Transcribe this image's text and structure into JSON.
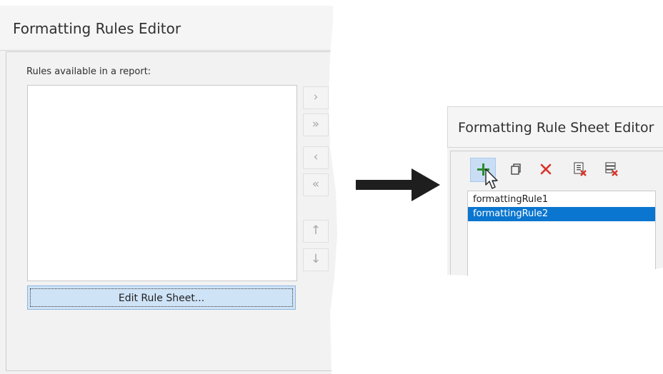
{
  "rules_editor": {
    "title": "Formatting Rules Editor",
    "rules_label": "Rules available in a report:",
    "side_buttons": [
      {
        "glyph": "›",
        "icon": "move-right-icon"
      },
      {
        "glyph": "»",
        "icon": "move-all-right-icon"
      },
      {
        "glyph": "‹",
        "icon": "move-left-icon"
      },
      {
        "glyph": "«",
        "icon": "move-all-left-icon"
      },
      {
        "glyph": "↑",
        "icon": "move-up-icon"
      },
      {
        "glyph": "↓",
        "icon": "move-down-icon"
      }
    ],
    "edit_button_label": "Edit Rule Sheet..."
  },
  "sheet_editor": {
    "title": "Formatting Rule Sheet Editor",
    "toolbar": [
      {
        "icon": "add-icon",
        "color": "#2e8b2e"
      },
      {
        "icon": "copy-icon",
        "color": "#3a3a3a"
      },
      {
        "icon": "delete-icon",
        "color": "#d9342b"
      },
      {
        "icon": "purge-icon",
        "color": "#d9342b"
      },
      {
        "icon": "clear-icon",
        "color": "#d9342b"
      }
    ],
    "rules": [
      {
        "label": "formattingRule1",
        "selected": false
      },
      {
        "label": "formattingRule2",
        "selected": true
      }
    ]
  },
  "colors": {
    "selection": "#0a76cf",
    "button_highlight": "#cfe3f7",
    "arrow": "#1e1e1e"
  }
}
